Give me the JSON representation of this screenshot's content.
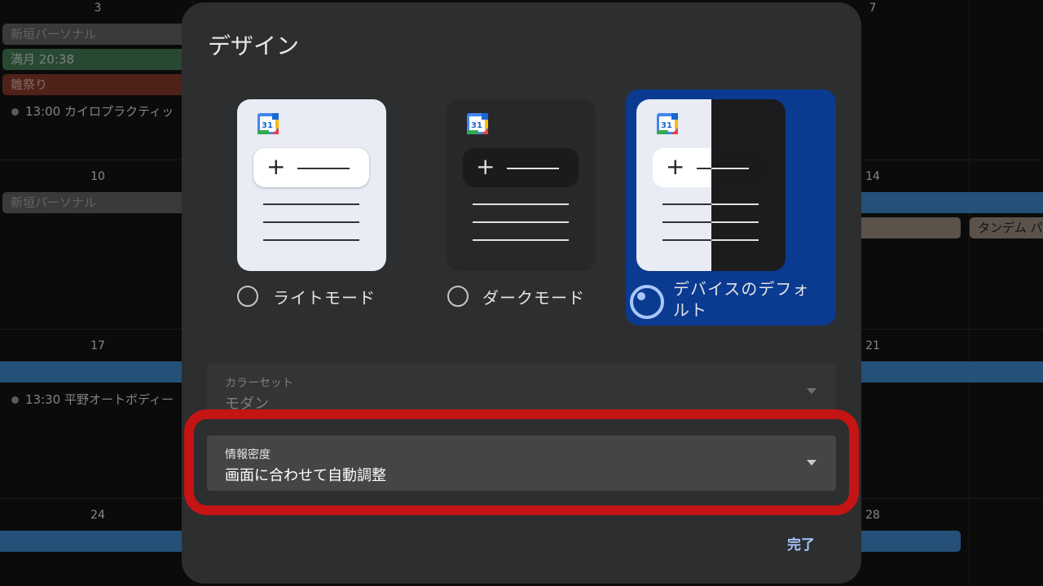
{
  "calendar": {
    "day_numbers": [
      "3",
      "7",
      "10",
      "14",
      "17",
      "21",
      "24",
      "28"
    ],
    "events": {
      "shingaki_1": "新垣パーソナル",
      "full_moon": "満月 20:38",
      "hinamatsuri": "雛祭り",
      "chiro": "13:00 カイロプラクティッ",
      "shingaki_2": "新垣パーソナル",
      "tandem": "タンデム パ",
      "hirano": "13:30 平野オートボディー"
    },
    "colors": {
      "chip_gray": "#5a5a5a",
      "chip_green": "#3f6f4e",
      "chip_red": "#7a3425",
      "chip_tan": "#8c7e72",
      "bar_blue": "#3a7cb8"
    }
  },
  "dialog": {
    "title": "デザイン",
    "themes": [
      {
        "label": "ライトモード",
        "icon": "calendar-31-icon",
        "selected": false
      },
      {
        "label": "ダークモード",
        "icon": "calendar-31-icon",
        "selected": false
      },
      {
        "label": "デバイスのデフォルト",
        "label_line1": "デバイスのデフォ",
        "label_line2": "ルト",
        "icon": "calendar-31-icon",
        "selected": true
      }
    ],
    "color_set": {
      "label": "カラーセット",
      "value": "モダン"
    },
    "density": {
      "label": "情報密度",
      "value": "画面に合わせて自動調整"
    },
    "done_label": "完了",
    "colors": {
      "dialog_bg": "#2d2e30",
      "selected_card": "#0b3a91",
      "accent": "#a8c7fa",
      "highlight_border": "#c41414"
    }
  }
}
